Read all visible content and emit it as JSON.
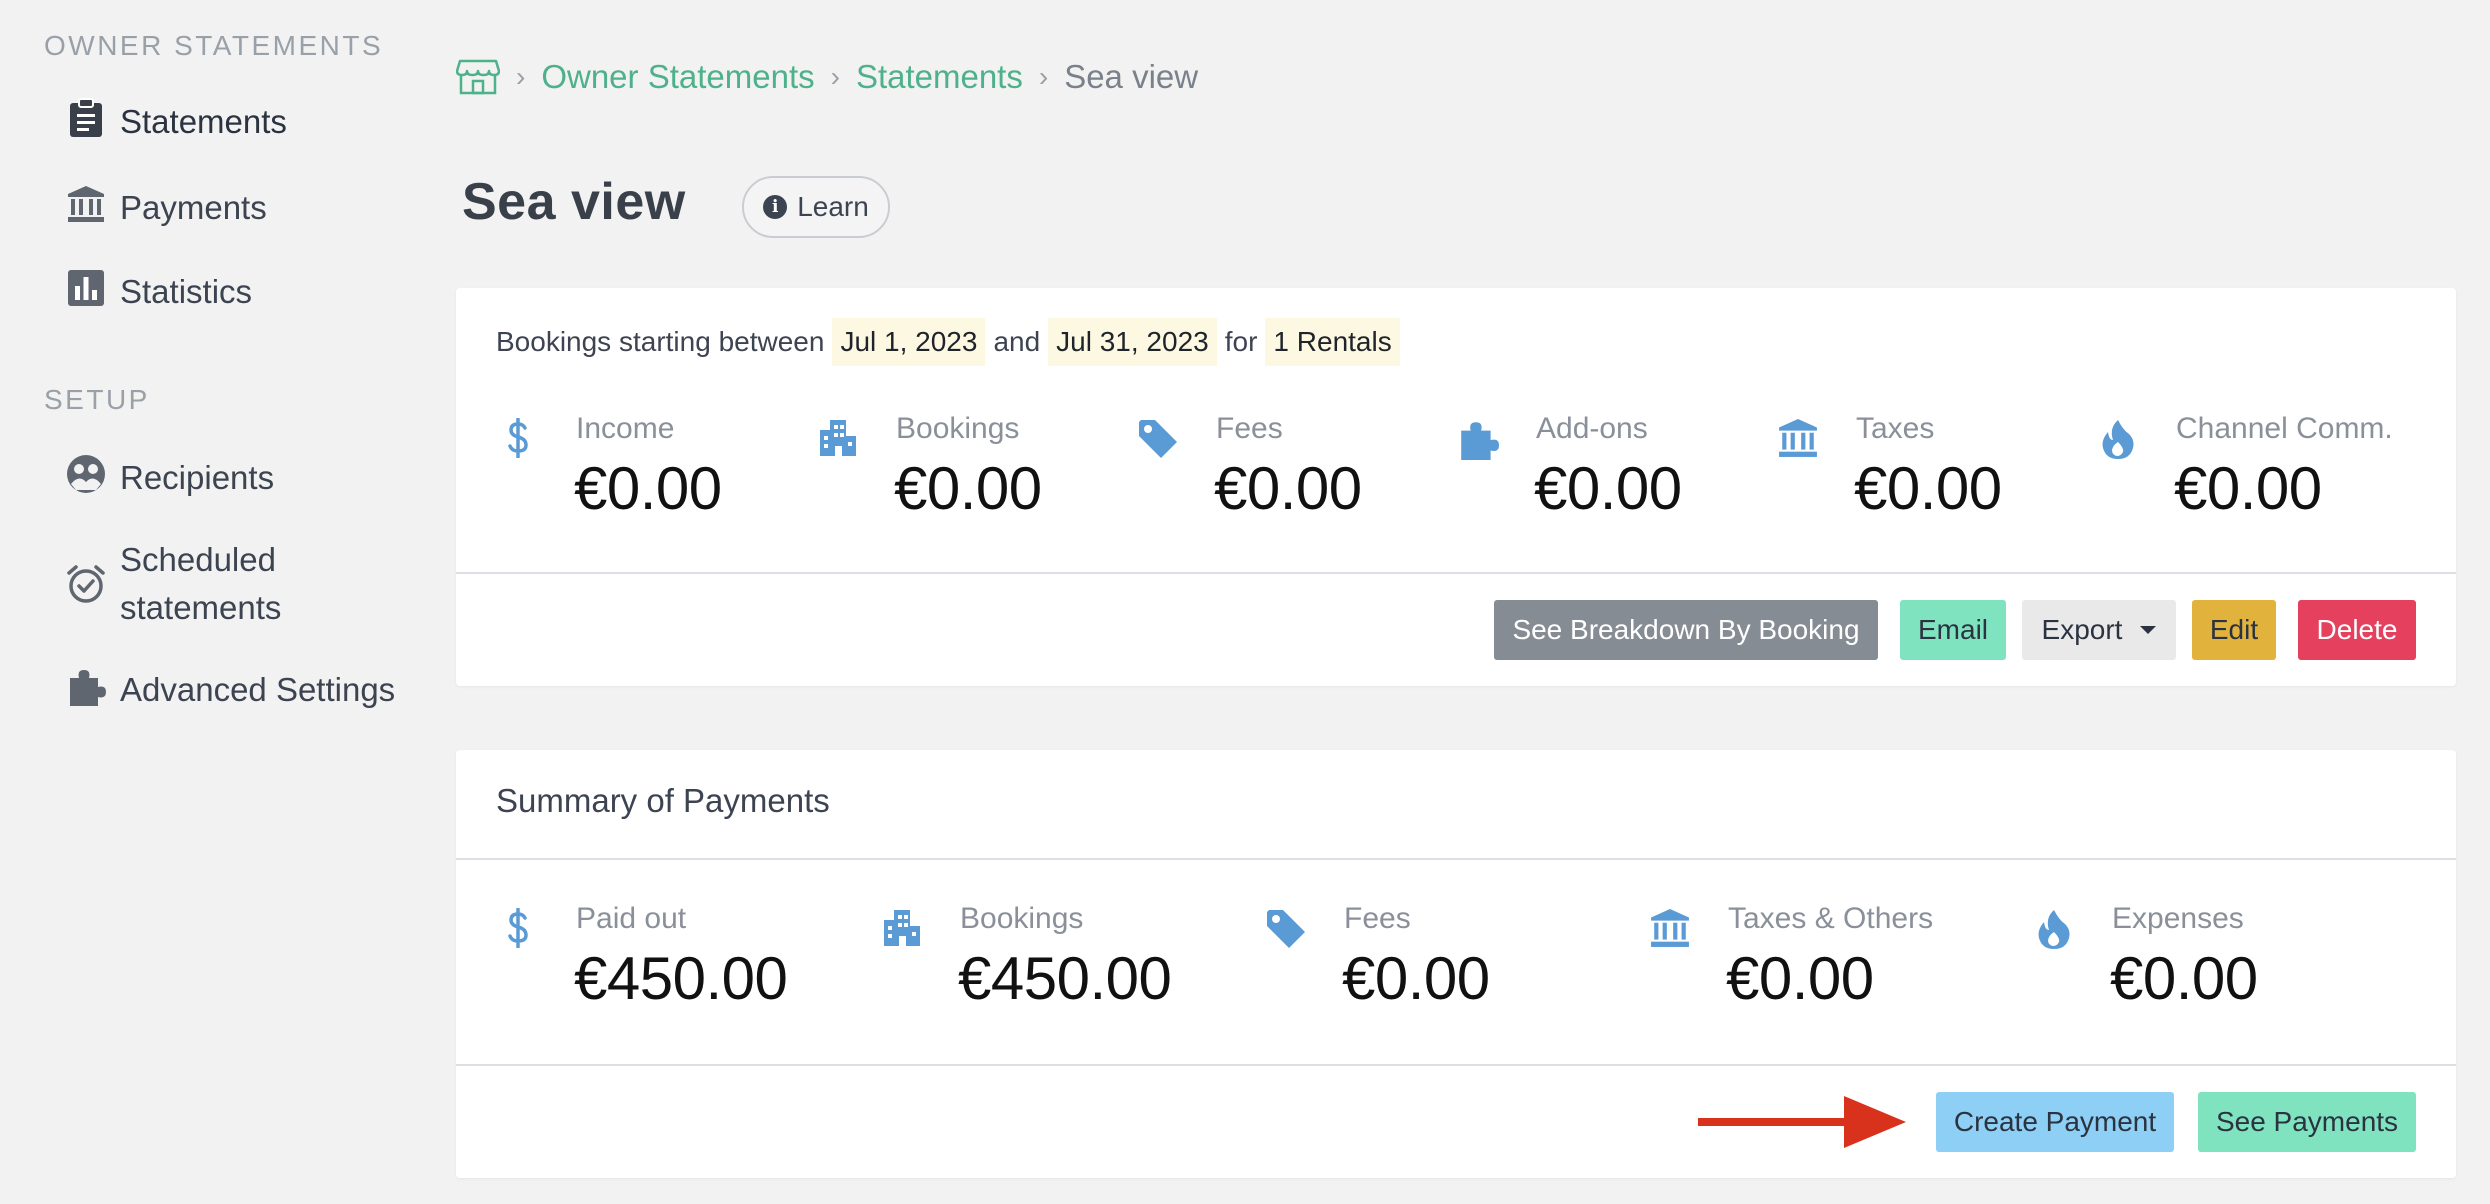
{
  "sidebar": {
    "owner_heading": "OWNER STATEMENTS",
    "setup_heading": "SETUP",
    "items": [
      {
        "label": "Statements",
        "icon": "clipboard-icon"
      },
      {
        "label": "Payments",
        "icon": "bank-icon"
      },
      {
        "label": "Statistics",
        "icon": "bar-chart-icon"
      },
      {
        "label": "Recipients",
        "icon": "users-circle-icon"
      },
      {
        "label": "Scheduled",
        "label2": "statements",
        "icon": "alarm-check-icon"
      },
      {
        "label": "Advanced Settings",
        "icon": "puzzle-icon"
      }
    ]
  },
  "breadcrumb": {
    "items": [
      "Owner Statements",
      "Statements",
      "Sea view"
    ]
  },
  "page": {
    "title": "Sea view",
    "learn_label": "Learn"
  },
  "statement": {
    "prefix": "Bookings starting between",
    "start_date": "Jul 1, 2023",
    "and": "and",
    "end_date": "Jul 31, 2023",
    "for": "for",
    "rentals": "1 Rentals",
    "stats": [
      {
        "label": "Income",
        "value": "€0.00",
        "icon": "dollar-icon"
      },
      {
        "label": "Bookings",
        "value": "€0.00",
        "icon": "building-icon"
      },
      {
        "label": "Fees",
        "value": "€0.00",
        "icon": "tag-icon"
      },
      {
        "label": "Add-ons",
        "value": "€0.00",
        "icon": "puzzle-icon"
      },
      {
        "label": "Taxes",
        "value": "€0.00",
        "icon": "bank-icon"
      },
      {
        "label": "Channel Comm.",
        "value": "€0.00",
        "icon": "flame-icon"
      }
    ],
    "buttons": {
      "breakdown": "See Breakdown By Booking",
      "email": "Email",
      "export": "Export",
      "edit": "Edit",
      "delete": "Delete"
    }
  },
  "payments_summary": {
    "title": "Summary of Payments",
    "stats": [
      {
        "label": "Paid out",
        "value": "€450.00",
        "icon": "dollar-icon"
      },
      {
        "label": "Bookings",
        "value": "€450.00",
        "icon": "building-icon"
      },
      {
        "label": "Fees",
        "value": "€0.00",
        "icon": "tag-icon"
      },
      {
        "label": "Taxes & Others",
        "value": "€0.00",
        "icon": "bank-icon"
      },
      {
        "label": "Expenses",
        "value": "€0.00",
        "icon": "flame-icon"
      }
    ],
    "buttons": {
      "create": "Create Payment",
      "see": "See Payments"
    }
  },
  "colors": {
    "accent_green": "#4fb08c",
    "icon_blue": "#5b9bd5",
    "delete_red": "#e5405e",
    "arrow_red": "#d9321c"
  }
}
